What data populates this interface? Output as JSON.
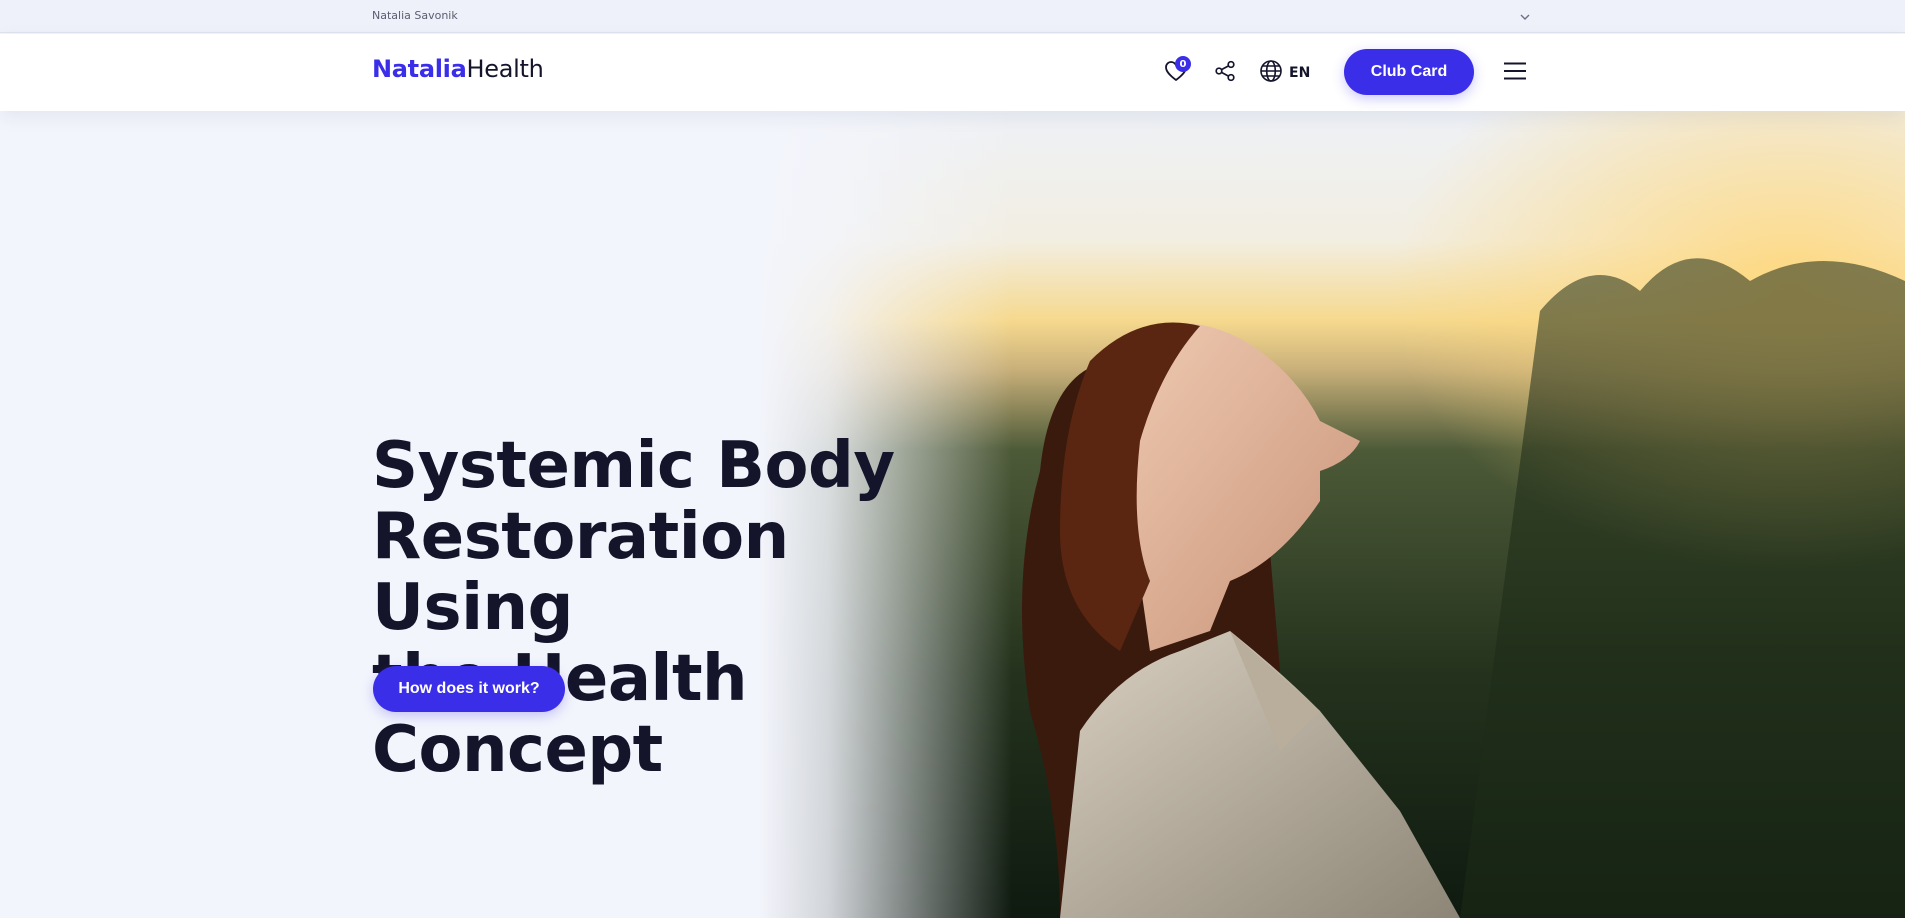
{
  "topbar": {
    "owner": "Natalia Savonik",
    "dropdown_icon": "chevron-down-icon"
  },
  "header": {
    "logo_brand": "Natalia",
    "logo_suffix": "Health",
    "wishlist_count": "0",
    "wishlist_icon": "heart-icon",
    "share_icon": "share-icon",
    "language_icon": "globe-icon",
    "language": "EN",
    "club_card_label": "Club Card",
    "menu_icon": "hamburger-menu-icon"
  },
  "hero": {
    "title_line1": "Systemic Body",
    "title_line2": "Restoration Using",
    "title_line3": "the Health Concept",
    "cta_label": "How does it work?",
    "image_subject": "woman-with-eyes-closed-at-sunset"
  },
  "colors": {
    "accent": "#3a2ee8",
    "text": "#14142b",
    "background": "#f3f5fc"
  }
}
